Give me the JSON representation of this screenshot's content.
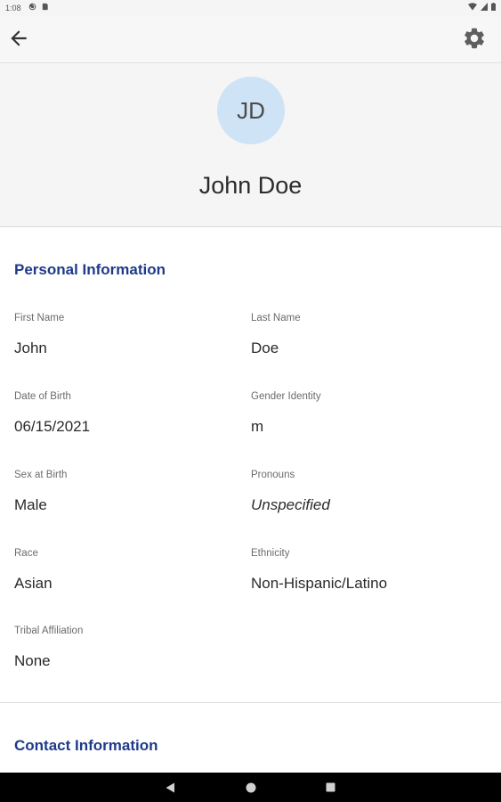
{
  "status_bar": {
    "time": "1:08"
  },
  "profile": {
    "initials": "JD",
    "name": "John Doe"
  },
  "personal_section": {
    "title": "Personal Information",
    "fields": [
      {
        "label": "First Name",
        "value": "John"
      },
      {
        "label": "Last Name",
        "value": "Doe"
      },
      {
        "label": "Date of Birth",
        "value": "06/15/2021"
      },
      {
        "label": "Gender Identity",
        "value": "m"
      },
      {
        "label": "Sex at Birth",
        "value": "Male"
      },
      {
        "label": "Pronouns",
        "value": "Unspecified"
      },
      {
        "label": "Race",
        "value": "Asian"
      },
      {
        "label": "Ethnicity",
        "value": "Non-Hispanic/Latino"
      },
      {
        "label": "Tribal Affiliation",
        "value": "None"
      }
    ]
  },
  "contact_section": {
    "title": "Contact Information"
  },
  "colors": {
    "accent": "#1f3a8a",
    "avatar_bg": "#cfe3f6",
    "header_bg": "#f5f5f5"
  },
  "icons": {
    "back": "arrow-left-icon",
    "settings": "gear-icon",
    "nav_back": "triangle-back-icon",
    "nav_home": "circle-home-icon",
    "nav_recents": "square-recents-icon"
  }
}
